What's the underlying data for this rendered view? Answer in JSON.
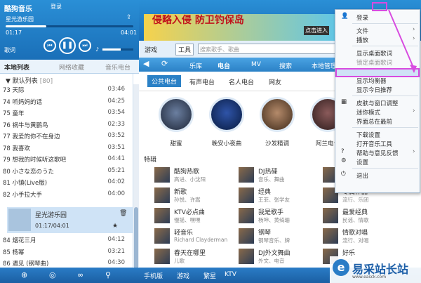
{
  "player": {
    "app_name": "酷狗音乐",
    "login": "登录",
    "current_song": "星光游乐园",
    "time_elapsed": "01:17",
    "time_total": "04:01",
    "lyrics_label": "歌词",
    "progress": 0.32,
    "volume": 0.6
  },
  "left_tabs": [
    "本地列表",
    "网络收藏",
    "音乐电台"
  ],
  "list_header": {
    "name": "默认列表",
    "count": "[80]"
  },
  "songs": [
    {
      "title": "73 天际",
      "dur": "03:46"
    },
    {
      "title": "74 听妈妈的话",
      "dur": "04:25"
    },
    {
      "title": "75 童年",
      "dur": "03:54"
    },
    {
      "title": "76 祸牛与黄鹂鸟",
      "dur": "02:33"
    },
    {
      "title": "77 我爱的你不在身边",
      "dur": "03:52"
    },
    {
      "title": "78 我喜欢",
      "dur": "03:51"
    },
    {
      "title": "79 想我的时候听这歌吧",
      "dur": "04:41"
    },
    {
      "title": "80 小さな恋のうた",
      "dur": "05:21"
    },
    {
      "title": "81 小镇(Live版)",
      "dur": "04:02"
    },
    {
      "title": "82 小手拉大手",
      "dur": "04:00"
    }
  ],
  "selected_song": {
    "title": "星光游乐园",
    "time": "01:17/04:01"
  },
  "songs_after": [
    {
      "title": "84 烟花三月",
      "dur": "04:12"
    },
    {
      "title": "85 杨幂",
      "dur": "03:21"
    },
    {
      "title": "86 遇见 (钢琴曲)",
      "dur": "04:30"
    }
  ],
  "ad": {
    "text": "侵略入侵 防卫钓保岛",
    "link": "点击进入"
  },
  "toolbar": {
    "game": "游戏",
    "tools": "工具",
    "search_placeholder": "搜索歌手、歌曲"
  },
  "nav": [
    "乐库",
    "电台",
    "MV",
    "搜索",
    "本地管理"
  ],
  "subtabs": [
    "公共电台",
    "有声电台",
    "名人电台",
    "网友"
  ],
  "stations": [
    "甜蜜",
    "晚安小夜曲",
    "沙发精调",
    "阿兰电台"
  ],
  "section_title": "特辑",
  "items": [
    {
      "t": "酷狗热歌",
      "s": "高进、小沈阳"
    },
    {
      "t": "DJ热碟",
      "s": "音乐、舞曲"
    },
    {
      "t": "专属榜单",
      "s": "热门单曲"
    },
    {
      "t": "新歌",
      "s": "孙悦、许嵩"
    },
    {
      "t": "经典",
      "s": "王菲、张学友"
    },
    {
      "t": "专属作品",
      "s": "流行、乐团"
    },
    {
      "t": "KTV必点曲",
      "s": "慢摇、嘿嘿"
    },
    {
      "t": "我是歌手",
      "s": "杨坤、黄绮珊"
    },
    {
      "t": "最爱经典",
      "s": "民谣、情歌"
    },
    {
      "t": "轻音乐",
      "s": "Richard Clayderman"
    },
    {
      "t": "钢琴",
      "s": "钢琴音乐、牌"
    },
    {
      "t": "情歌对唱",
      "s": "流行、对唱"
    },
    {
      "t": "春天在哪里",
      "s": "儿歌"
    },
    {
      "t": "DJ外文舞曲",
      "s": "外文、电音"
    },
    {
      "t": "好乐",
      "s": "古典"
    }
  ],
  "menu": {
    "items": [
      {
        "label": "登录",
        "icon": "user-icon"
      },
      {
        "label": "文件",
        "arrow": true
      },
      {
        "label": "播放",
        "arrow": true
      },
      {
        "label": "显示桌面歌词"
      },
      {
        "label": "锁定桌面歌词",
        "disabled": true
      },
      {
        "label": "显示音效插件",
        "highlighted": true
      },
      {
        "label": "显示均衡器"
      },
      {
        "label": "显示今日推荐"
      },
      {
        "label": "皮肤与窗口调整",
        "icon": "palette-icon"
      },
      {
        "label": "迷你模式",
        "arrow": true
      },
      {
        "label": "界面总在最前"
      },
      {
        "label": "下载设置"
      },
      {
        "label": "打开音乐工具"
      },
      {
        "label": "帮助与意见反馈",
        "icon": "help-icon",
        "arrow": true
      },
      {
        "label": "设置",
        "icon": "gear-icon"
      },
      {
        "label": "退出",
        "icon": "power-icon"
      }
    ]
  },
  "bottom": [
    "手机版",
    "游戏",
    "繁星",
    "KTV"
  ],
  "watermark": {
    "text": "易采站长站",
    "url": "www.easck.com"
  },
  "colors": {
    "accent": "#1a6fb8",
    "highlight_border": "#d84be0"
  }
}
